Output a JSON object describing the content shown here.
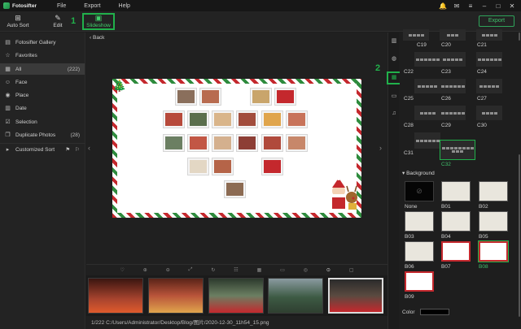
{
  "app": {
    "name": "Fotosifter"
  },
  "menu": [
    "File",
    "Export",
    "Help"
  ],
  "toolbar": {
    "auto_sort": "Auto Sort",
    "edit": "Edit",
    "slideshow": "Slideshow",
    "export": "Export"
  },
  "annotations": {
    "step1": "1",
    "step2": "2"
  },
  "sidebar": {
    "items": [
      {
        "label": "Fotosifter Gallery",
        "icon": "gallery-icon",
        "count": ""
      },
      {
        "label": "Favorites",
        "icon": "star-icon",
        "count": ""
      },
      {
        "label": "All",
        "icon": "grid-icon",
        "count": "(222)"
      },
      {
        "label": "Face",
        "icon": "face-icon",
        "count": ""
      },
      {
        "label": "Place",
        "icon": "location-pin-icon",
        "count": ""
      },
      {
        "label": "Date",
        "icon": "calendar-icon",
        "count": ""
      },
      {
        "label": "Selection",
        "icon": "checkbox-icon",
        "count": ""
      },
      {
        "label": "Duplicate Photos",
        "icon": "duplicate-icon",
        "count": "(28)"
      },
      {
        "label": "Customized Sort",
        "icon": "caret-right-icon",
        "count": ""
      }
    ]
  },
  "center": {
    "back": "Back"
  },
  "pathbar": {
    "text": "1/222   C:/Users/Administrator/Desktop/Blog/图片/2020-12-30_11h54_15.png"
  },
  "layouts": {
    "items": [
      "C19",
      "C20",
      "C21",
      "C22",
      "C23",
      "C24",
      "C25",
      "C26",
      "C27",
      "C28",
      "C29",
      "C30",
      "C31",
      "C32"
    ],
    "selected": "C32"
  },
  "background": {
    "title": "Background",
    "items": [
      "None",
      "B01",
      "B02",
      "B03",
      "B04",
      "B05",
      "B06",
      "B07",
      "B08",
      "B09"
    ],
    "selected": "B08"
  },
  "color": {
    "label": "Color",
    "value": "#000000"
  },
  "colors": {
    "accent": "#21b14b",
    "festive_red": "#c4282d",
    "festive_green": "#2e8b3d"
  }
}
